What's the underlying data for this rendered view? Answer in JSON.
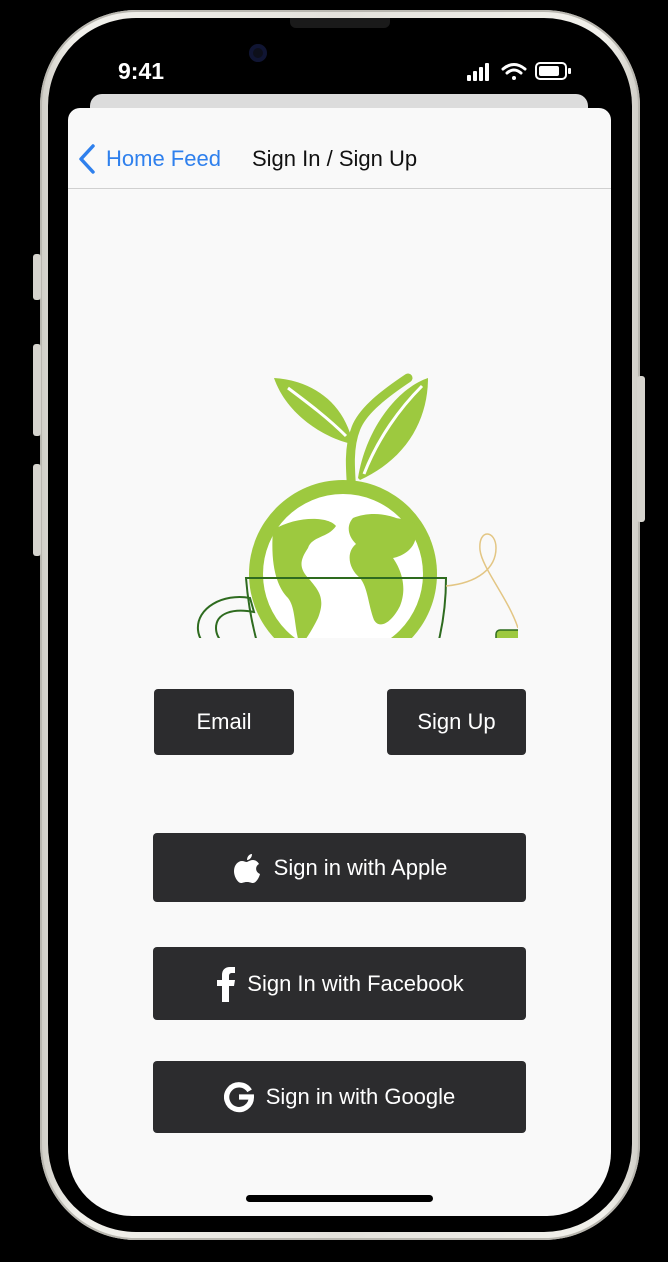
{
  "status_bar": {
    "time": "9:41"
  },
  "nav": {
    "back_label": "Home Feed",
    "title": "Sign In / Sign Up"
  },
  "buttons": {
    "email_label": "Email",
    "sign_up_label": "Sign Up",
    "apple_label": "Sign in with Apple",
    "facebook_label": "Sign In with Facebook",
    "google_label": "Sign in with Google"
  },
  "logo": {
    "icon": "tea-cup-globe-sprout-logo"
  },
  "colors": {
    "accent": "#2f80ed",
    "button_bg": "#2c2c2e",
    "logo_green": "#9dc93f",
    "cup_outline": "#2e6b1f",
    "screen_bg": "#f9f9f9"
  }
}
